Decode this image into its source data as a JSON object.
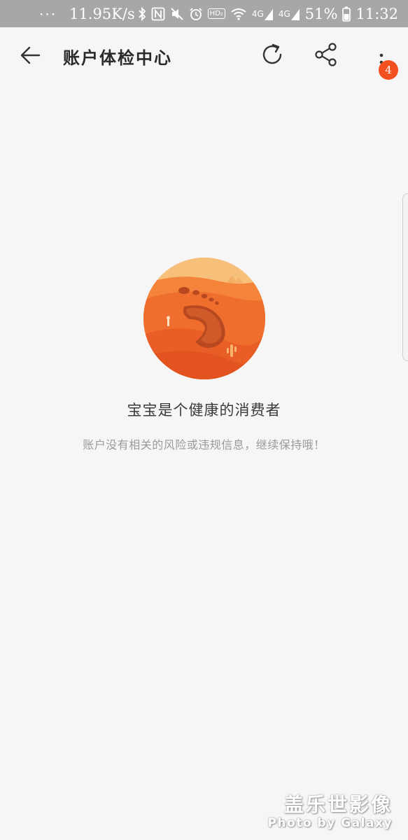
{
  "status_bar": {
    "dots": "···",
    "speed": "11.95K/s",
    "hd_label": "HD₂",
    "network_4g_1": "4G",
    "network_4g_2": "4G",
    "battery_percent": "51%",
    "time": "11:32",
    "icons": [
      "bluetooth-icon",
      "nfc-icon",
      "mute-icon",
      "alarm-icon",
      "hd-voice-icon",
      "wifi-icon",
      "signal-icon",
      "battery-icon"
    ]
  },
  "header": {
    "title": "账户体检中心",
    "notification_count": "4",
    "icons": [
      "back-arrow-icon",
      "refresh-icon",
      "share-icon",
      "more-vertical-icon"
    ]
  },
  "main": {
    "illustration": "footprint-desert-icon",
    "title": "宝宝是个健康的消费者",
    "subtitle": "账户没有相关的风险或违规信息，继续保持哦！"
  },
  "watermark": {
    "cn": "盖乐世影像",
    "en": "Photo by Galaxy"
  },
  "colors": {
    "status_bar_bg": "#a7a7a7",
    "page_bg": "#f6f6f6",
    "badge": "#f2501e",
    "illustration_orange": "#ef6a2c"
  }
}
